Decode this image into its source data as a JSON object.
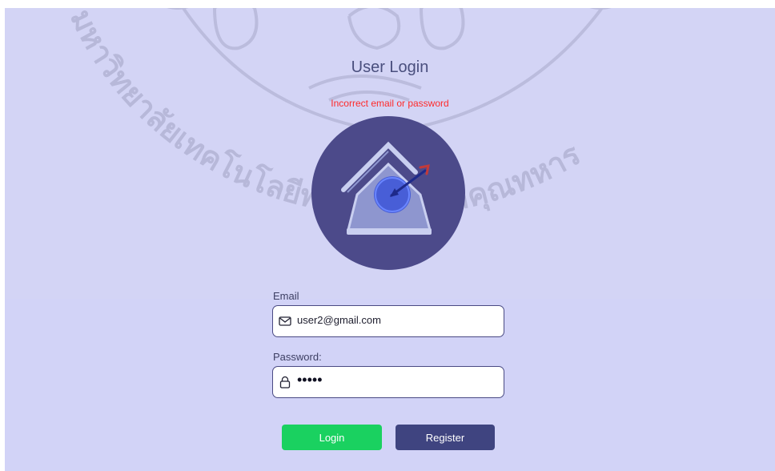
{
  "page": {
    "title": "User Login",
    "error_message": "Incorrect email or password"
  },
  "form": {
    "email": {
      "label": "Email",
      "value": "user2@gmail.com",
      "icon": "envelope-icon"
    },
    "password": {
      "label": "Password:",
      "value": "•••••",
      "icon": "lock-icon"
    }
  },
  "buttons": {
    "login_label": "Login",
    "register_label": "Register"
  },
  "watermark": {
    "text": "มหาวิทยาลัยเทคโนโลยีพระจอมเกล้าคุณทหาร"
  },
  "colors": {
    "background": "#d3d4f5",
    "error": "#ff2a2a",
    "login_button": "#1ad160",
    "register_button": "#3f4480",
    "logo_circle": "#4c4a8a"
  }
}
